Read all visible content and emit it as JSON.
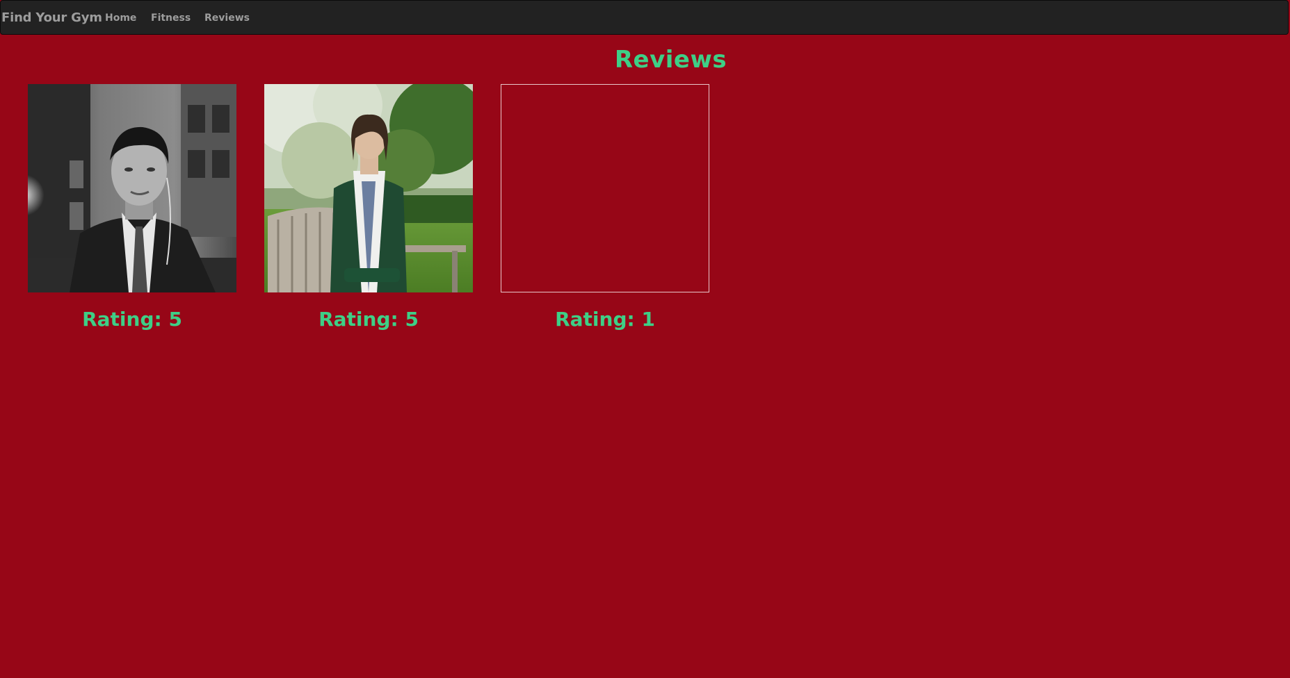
{
  "navbar": {
    "brand": "Find Your Gym",
    "items": [
      {
        "label": "Home"
      },
      {
        "label": "Fitness"
      },
      {
        "label": "Reviews"
      }
    ]
  },
  "page": {
    "title": "Reviews",
    "background_color": "#970617",
    "accent_color": "#3ecf86"
  },
  "reviews": [
    {
      "rating_text": "Rating: 5",
      "photo": "man-in-suit-photo"
    },
    {
      "rating_text": "Rating: 5",
      "photo": "woman-in-graduation-gown-photo"
    },
    {
      "rating_text": "Rating: 1",
      "photo": "empty-photo-frame"
    }
  ]
}
